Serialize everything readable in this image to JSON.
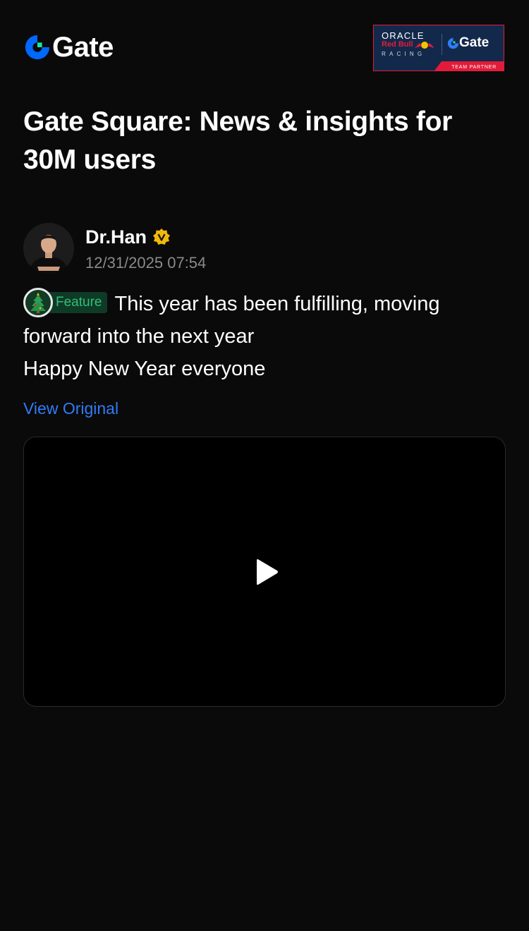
{
  "header": {
    "brand": "Gate",
    "partner_badge": {
      "oracle": "ORACLE",
      "red_bull": "Red Bull",
      "racing": "RACING",
      "partner_brand": "Gate",
      "partner_label": "TEAM PARTNER"
    }
  },
  "headline": "Gate Square: News & insights for 30M users",
  "post": {
    "author": "Dr.Han",
    "verified_icon": "verified-badge-icon",
    "timestamp": "12/31/2025 07:54",
    "tag": "Feature",
    "tag_icon": "christmas-tree-icon",
    "lines": [
      "This year has been fulfilling, moving forward into the next year",
      "Happy New Year everyone"
    ],
    "view_original": "View Original"
  },
  "video": {
    "icon": "play-icon"
  },
  "colors": {
    "background": "#0a0a0a",
    "brand_blue": "#0068ff",
    "brand_green": "#17e6a1",
    "link_blue": "#2f7cf6",
    "tag_green": "#2fc07a",
    "verified_gold": "#f0b90b",
    "partner_navy": "#13294b",
    "partner_red": "#e31b3a"
  }
}
